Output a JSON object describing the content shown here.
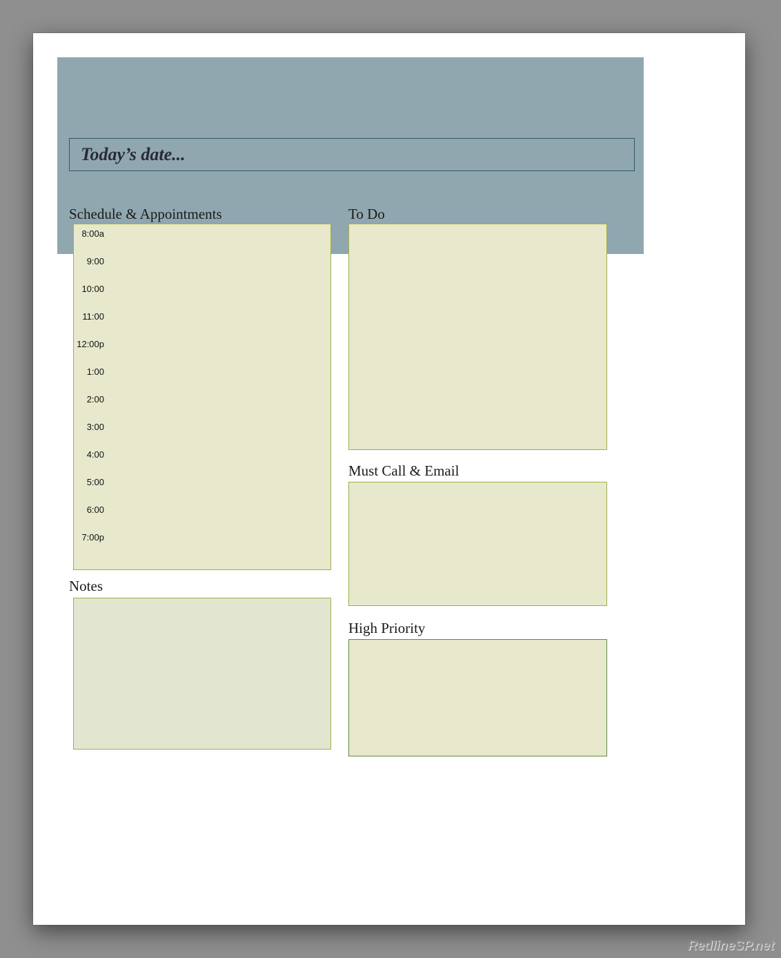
{
  "date": {
    "placeholder": "Today’s date..."
  },
  "sections": {
    "schedule": {
      "title": "Schedule & Appointments",
      "times": [
        "8:00a",
        "9:00",
        "10:00",
        "11:00",
        "12:00p",
        "1:00",
        "2:00",
        "3:00",
        "4:00",
        "5:00",
        "6:00",
        "7:00p"
      ]
    },
    "todo": {
      "title": "To Do"
    },
    "notes": {
      "title": "Notes"
    },
    "mustcall": {
      "title": "Must Call & Email"
    },
    "priority": {
      "title": "High Priority"
    }
  },
  "watermark": "RedlineSP.net"
}
